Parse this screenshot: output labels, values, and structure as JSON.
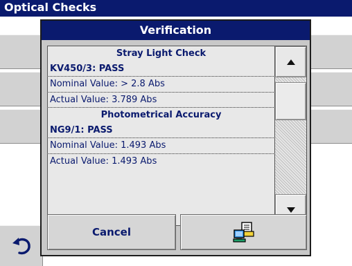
{
  "background": {
    "title": "Optical Checks"
  },
  "dialog": {
    "title": "Verification",
    "sections": [
      {
        "heading": "Stray Light Check",
        "status": "KV450/3: PASS",
        "nominal": "Nominal Value: > 2.8 Abs",
        "actual": "Actual Value:   3.789 Abs"
      },
      {
        "heading": "Photometrical Accuracy",
        "status": "NG9/1: PASS",
        "nominal": "Nominal Value:   1.493 Abs",
        "actual": "Actual Value:   1.493 Abs"
      }
    ],
    "cancel_label": "Cancel",
    "print_icon": "computer-printer-icon",
    "scroll_up_icon": "triangle-up-icon",
    "scroll_down_icon": "triangle-down-icon"
  },
  "back_icon": "back-arrow-icon",
  "colors": {
    "title_bar": "#0a1a6e",
    "panel": "#c8c8c8",
    "text": "#0a1a6e"
  }
}
